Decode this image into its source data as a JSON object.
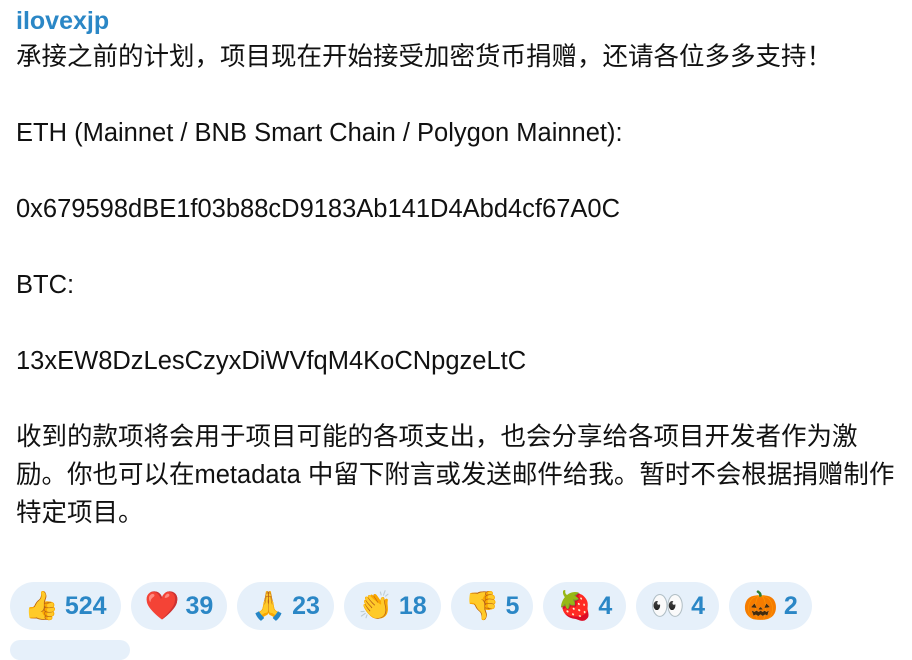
{
  "message": {
    "sender": "ilovexjp",
    "text": "承接之前的计划，项目现在开始接受加密货币捐赠，还请各位多多支持！\n\nETH (Mainnet / BNB Smart Chain / Polygon Mainnet):\n\n0x679598dBE1f03b88cD9183Ab141D4Abd4cf67A0C\n\nBTC:\n\n13xEW8DzLesCzyxDiWVfqM4KoCNpgzeLtC\n\n收到的款项将会用于项目可能的各项支出，也会分享给各项目开发者作为激励。你也可以在metadata 中留下附言或发送邮件给我。暂时不会根据捐赠制作特定项目。"
  },
  "reactions": [
    {
      "emoji": "👍",
      "icon": "thumbs-up-icon",
      "count": "524"
    },
    {
      "emoji": "❤️",
      "icon": "heart-icon",
      "count": "39"
    },
    {
      "emoji": "🙏",
      "icon": "praying-hands-icon",
      "count": "23"
    },
    {
      "emoji": "👏",
      "icon": "clapping-hands-icon",
      "count": "18"
    },
    {
      "emoji": "👎",
      "icon": "thumbs-down-icon",
      "count": "5"
    },
    {
      "emoji": "🍓",
      "icon": "strawberry-icon",
      "count": "4"
    },
    {
      "emoji": "👀",
      "icon": "eyes-icon",
      "count": "4"
    },
    {
      "emoji": "🎃",
      "icon": "pumpkin-icon",
      "count": "2"
    }
  ],
  "colors": {
    "accent": "#2b87c6",
    "reaction_bg": "#e6f0fa",
    "text": "#111111"
  }
}
